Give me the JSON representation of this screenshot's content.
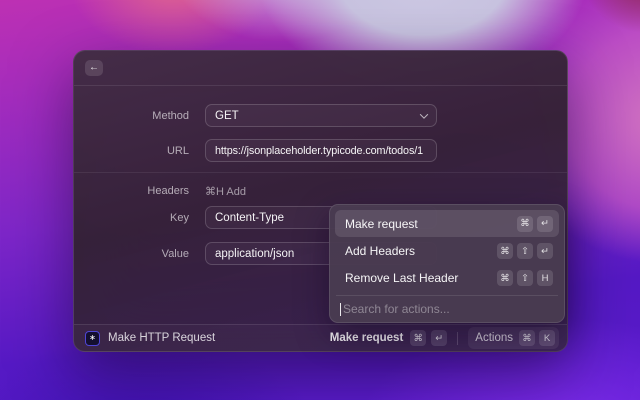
{
  "window_title": "Make HTTP Request",
  "icons": {
    "back_arrow": "←",
    "extension_glyph": "∗"
  },
  "form": {
    "method_label": "Method",
    "method_value": "GET",
    "url_label": "URL",
    "url_value": "https://jsonplaceholder.typicode.com/todos/1",
    "headers_label": "Headers",
    "headers_add_hint": "⌘H Add",
    "key_label": "Key",
    "key_value": "Content-Type",
    "value_label": "Value",
    "value_value": "application/json"
  },
  "actions_menu": {
    "items": [
      {
        "label": "Make request",
        "selected": true,
        "keys": [
          "⌘",
          "↵"
        ]
      },
      {
        "label": "Add Headers",
        "selected": false,
        "keys": [
          "⌘",
          "⇧",
          "↵"
        ]
      },
      {
        "label": "Remove Last Header",
        "selected": false,
        "keys": [
          "⌘",
          "⇧",
          "H"
        ]
      }
    ],
    "search_placeholder": "Search for actions..."
  },
  "status_bar": {
    "extension_title": "Make HTTP Request",
    "primary_action_label": "Make request",
    "primary_action_keys": [
      "⌘",
      "↵"
    ],
    "actions_label": "Actions",
    "actions_keys": [
      "⌘",
      "K"
    ]
  },
  "colors": {
    "window_bg": "#3a2942",
    "menu_bg": "#493b51",
    "menu_selection": "#5d4d65",
    "wallpaper_magenta": "#bd30b3",
    "wallpaper_lavender": "#c8c3e0",
    "wallpaper_violet": "#5a1ccc",
    "extension_icon_ring": "#4f46d6"
  }
}
